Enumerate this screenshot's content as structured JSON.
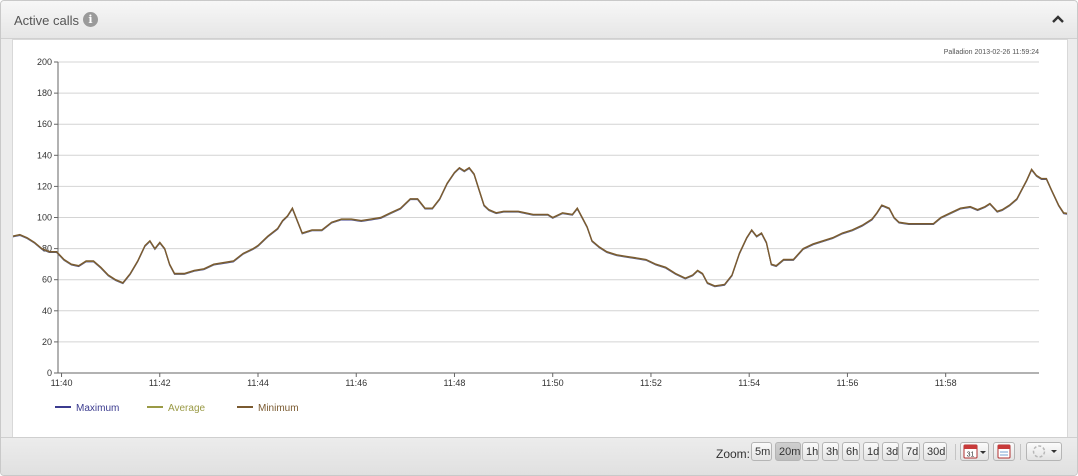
{
  "header": {
    "title": "Active calls",
    "info_icon": "info-icon",
    "collapse_icon": "chevron-up-icon"
  },
  "chart_data": {
    "type": "line",
    "watermark": "Palladion 2013-02-26 11:59:24",
    "x_ticks": [
      "11:40",
      "11:42",
      "11:44",
      "11:46",
      "11:48",
      "11:50",
      "11:52",
      "11:54",
      "11:56",
      "11:58"
    ],
    "x_range_minutes": [
      0,
      20
    ],
    "ylim": [
      0,
      200
    ],
    "y_ticks": [
      0,
      20,
      40,
      60,
      80,
      100,
      120,
      140,
      160,
      180,
      200
    ],
    "grid": "horizontal",
    "legend_position": "bottom-left",
    "series": [
      {
        "name": "Maximum",
        "color": "#3b3b8f"
      },
      {
        "name": "Average",
        "color": "#9a9a45"
      },
      {
        "name": "Minimum",
        "color": "#7a5a30"
      }
    ],
    "points": [
      [
        0.0,
        88
      ],
      [
        0.15,
        89
      ],
      [
        0.3,
        87
      ],
      [
        0.45,
        84
      ],
      [
        0.6,
        80
      ],
      [
        0.75,
        78
      ],
      [
        0.9,
        78
      ],
      [
        1.05,
        73
      ],
      [
        1.2,
        70
      ],
      [
        1.35,
        69
      ],
      [
        1.5,
        72
      ],
      [
        1.65,
        72
      ],
      [
        1.8,
        68
      ],
      [
        1.95,
        63
      ],
      [
        2.1,
        60
      ],
      [
        2.25,
        58
      ],
      [
        2.4,
        64
      ],
      [
        2.55,
        72
      ],
      [
        2.7,
        82
      ],
      [
        2.8,
        85
      ],
      [
        2.9,
        80
      ],
      [
        3.0,
        84
      ],
      [
        3.1,
        80
      ],
      [
        3.2,
        70
      ],
      [
        3.3,
        64
      ],
      [
        3.5,
        64
      ],
      [
        3.7,
        66
      ],
      [
        3.9,
        67
      ],
      [
        4.1,
        70
      ],
      [
        4.3,
        71
      ],
      [
        4.5,
        72
      ],
      [
        4.7,
        77
      ],
      [
        4.9,
        80
      ],
      [
        5.0,
        82
      ],
      [
        5.2,
        88
      ],
      [
        5.4,
        93
      ],
      [
        5.5,
        98
      ],
      [
        5.6,
        101
      ],
      [
        5.7,
        106
      ],
      [
        5.8,
        98
      ],
      [
        5.9,
        90
      ],
      [
        6.1,
        92
      ],
      [
        6.3,
        92
      ],
      [
        6.5,
        97
      ],
      [
        6.7,
        99
      ],
      [
        6.9,
        99
      ],
      [
        7.1,
        98
      ],
      [
        7.3,
        99
      ],
      [
        7.5,
        100
      ],
      [
        7.7,
        103
      ],
      [
        7.9,
        106
      ],
      [
        8.1,
        112
      ],
      [
        8.25,
        112
      ],
      [
        8.4,
        106
      ],
      [
        8.55,
        106
      ],
      [
        8.7,
        112
      ],
      [
        8.85,
        122
      ],
      [
        9.0,
        129
      ],
      [
        9.1,
        132
      ],
      [
        9.2,
        130
      ],
      [
        9.3,
        132
      ],
      [
        9.4,
        128
      ],
      [
        9.5,
        118
      ],
      [
        9.6,
        108
      ],
      [
        9.7,
        105
      ],
      [
        9.85,
        103
      ],
      [
        10.0,
        104
      ],
      [
        10.3,
        104
      ],
      [
        10.6,
        102
      ],
      [
        10.9,
        102
      ],
      [
        11.0,
        100
      ],
      [
        11.2,
        103
      ],
      [
        11.4,
        102
      ],
      [
        11.5,
        106
      ],
      [
        11.6,
        100
      ],
      [
        11.7,
        94
      ],
      [
        11.8,
        85
      ],
      [
        11.95,
        81
      ],
      [
        12.1,
        78
      ],
      [
        12.3,
        76
      ],
      [
        12.5,
        75
      ],
      [
        12.7,
        74
      ],
      [
        12.9,
        73
      ],
      [
        13.1,
        70
      ],
      [
        13.3,
        68
      ],
      [
        13.5,
        64
      ],
      [
        13.7,
        61
      ],
      [
        13.85,
        63
      ],
      [
        13.95,
        66
      ],
      [
        14.05,
        64
      ],
      [
        14.15,
        58
      ],
      [
        14.3,
        56
      ],
      [
        14.5,
        57
      ],
      [
        14.65,
        63
      ],
      [
        14.8,
        77
      ],
      [
        14.95,
        87
      ],
      [
        15.05,
        92
      ],
      [
        15.15,
        88
      ],
      [
        15.25,
        90
      ],
      [
        15.35,
        84
      ],
      [
        15.45,
        70
      ],
      [
        15.55,
        69
      ],
      [
        15.7,
        73
      ],
      [
        15.9,
        73
      ],
      [
        16.1,
        80
      ],
      [
        16.3,
        83
      ],
      [
        16.5,
        85
      ],
      [
        16.7,
        87
      ],
      [
        16.9,
        90
      ],
      [
        17.1,
        92
      ],
      [
        17.3,
        95
      ],
      [
        17.5,
        99
      ],
      [
        17.6,
        103
      ],
      [
        17.7,
        108
      ],
      [
        17.85,
        106
      ],
      [
        17.95,
        100
      ],
      [
        18.05,
        97
      ],
      [
        18.25,
        96
      ],
      [
        18.5,
        96
      ],
      [
        18.75,
        96
      ],
      [
        18.9,
        100
      ],
      [
        19.1,
        103
      ],
      [
        19.3,
        106
      ],
      [
        19.5,
        107
      ],
      [
        19.65,
        105
      ],
      [
        19.8,
        107
      ],
      [
        19.9,
        109
      ],
      [
        20.05,
        104
      ],
      [
        20.15,
        105
      ],
      [
        20.3,
        108
      ],
      [
        20.45,
        112
      ],
      [
        20.55,
        118
      ],
      [
        20.65,
        124
      ],
      [
        20.75,
        131
      ],
      [
        20.85,
        127
      ],
      [
        20.95,
        125
      ],
      [
        21.05,
        125
      ],
      [
        21.15,
        118
      ],
      [
        21.3,
        108
      ],
      [
        21.4,
        103
      ],
      [
        21.6,
        102
      ],
      [
        21.8,
        100
      ],
      [
        22.0,
        98
      ],
      [
        22.2,
        97
      ],
      [
        22.4,
        95
      ],
      [
        22.6,
        93
      ],
      [
        22.8,
        93
      ],
      [
        23.0,
        92
      ],
      [
        23.1,
        95
      ],
      [
        23.2,
        93
      ],
      [
        23.3,
        95
      ],
      [
        23.4,
        92
      ],
      [
        23.5,
        85
      ],
      [
        23.6,
        78
      ],
      [
        23.7,
        72
      ],
      [
        23.9,
        70
      ],
      [
        24.1,
        69
      ],
      [
        24.3,
        68
      ],
      [
        24.5,
        68
      ],
      [
        24.7,
        67
      ],
      [
        24.9,
        64
      ],
      [
        25.05,
        60
      ],
      [
        25.15,
        55
      ],
      [
        25.3,
        57
      ],
      [
        25.5,
        62
      ],
      [
        25.7,
        65
      ],
      [
        25.85,
        64
      ],
      [
        26.0,
        66
      ],
      [
        26.2,
        70
      ],
      [
        26.35,
        77
      ],
      [
        26.55,
        88
      ],
      [
        26.7,
        96
      ],
      [
        26.85,
        95
      ],
      [
        27.0,
        90
      ],
      [
        27.1,
        92
      ],
      [
        27.2,
        84
      ],
      [
        27.3,
        79
      ],
      [
        27.5,
        82
      ],
      [
        27.7,
        85
      ],
      [
        27.9,
        88
      ],
      [
        28.1,
        89
      ],
      [
        28.3,
        89
      ],
      [
        28.5,
        90
      ],
      [
        28.6,
        92
      ]
    ]
  },
  "toolbar": {
    "zoom_label": "Zoom:",
    "zoom_options": [
      "5m",
      "20m",
      "1h",
      "3h",
      "6h",
      "1d",
      "3d",
      "7d",
      "30d"
    ],
    "zoom_selected": "20m",
    "calendar_day": "31"
  }
}
